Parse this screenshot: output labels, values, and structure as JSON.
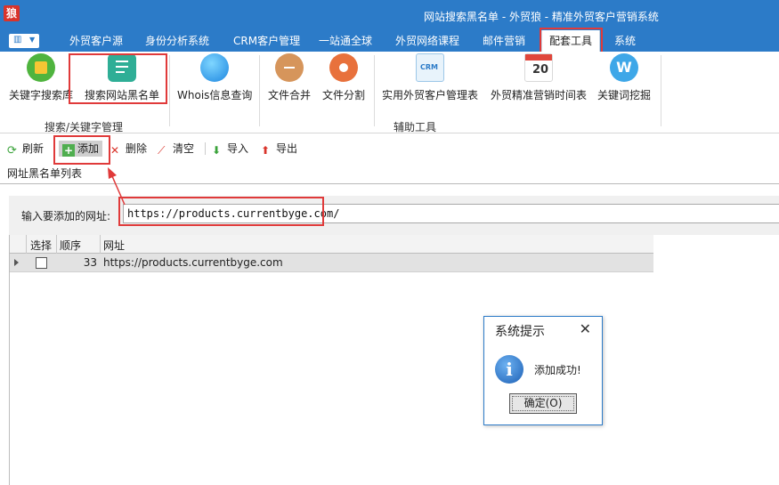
{
  "window": {
    "logo": "狼",
    "title": "网站搜索黑名单 - 外贸狼 - 精准外贸客户营销系统"
  },
  "menu": {
    "tabs": [
      {
        "label": "外贸客户源"
      },
      {
        "label": "身份分析系统"
      },
      {
        "label": "CRM客户管理"
      },
      {
        "label": "一站通全球"
      },
      {
        "label": "外贸网络课程"
      },
      {
        "label": "邮件营销"
      },
      {
        "label": "配套工具"
      },
      {
        "label": "系统"
      }
    ],
    "active_tab": "配套工具"
  },
  "ribbon": {
    "items": [
      {
        "label": "关键字搜索库",
        "icon": "shopping-bag-icon"
      },
      {
        "label": "搜索网站黑名单",
        "icon": "checklist-icon"
      },
      {
        "label": "Whois信息查询",
        "icon": "globe-icon"
      },
      {
        "label": "文件合并",
        "icon": "merge-icon"
      },
      {
        "label": "文件分割",
        "icon": "split-icon"
      },
      {
        "label": "实用外贸客户管理表",
        "icon": "crm-icon"
      },
      {
        "label": "外贸精准营销时间表",
        "icon": "calendar-icon"
      },
      {
        "label": "关键词挖掘",
        "icon": "w-icon"
      }
    ],
    "groups": [
      {
        "label": "搜索/关键字管理"
      },
      {
        "label": "辅助工具"
      }
    ]
  },
  "toolbar": {
    "refresh": "刷新",
    "add": "添加",
    "delete": "删除",
    "clear": "清空",
    "import": "导入",
    "export": "导出"
  },
  "list": {
    "tab_title": "网址黑名单列表",
    "input_label": "输入要添加的网址:",
    "input_value": "https://products.currentbyge.com/",
    "columns": [
      "选择",
      "顺序",
      "网址"
    ],
    "rows": [
      {
        "checked": false,
        "order": "33",
        "url": "https://products.currentbyge.com"
      }
    ]
  },
  "dialog": {
    "title": "系统提示",
    "message": "添加成功!",
    "ok_label": "确定(O)"
  },
  "colors": {
    "titlebar": "#2c7bc8",
    "highlight": "#e03a3a"
  }
}
